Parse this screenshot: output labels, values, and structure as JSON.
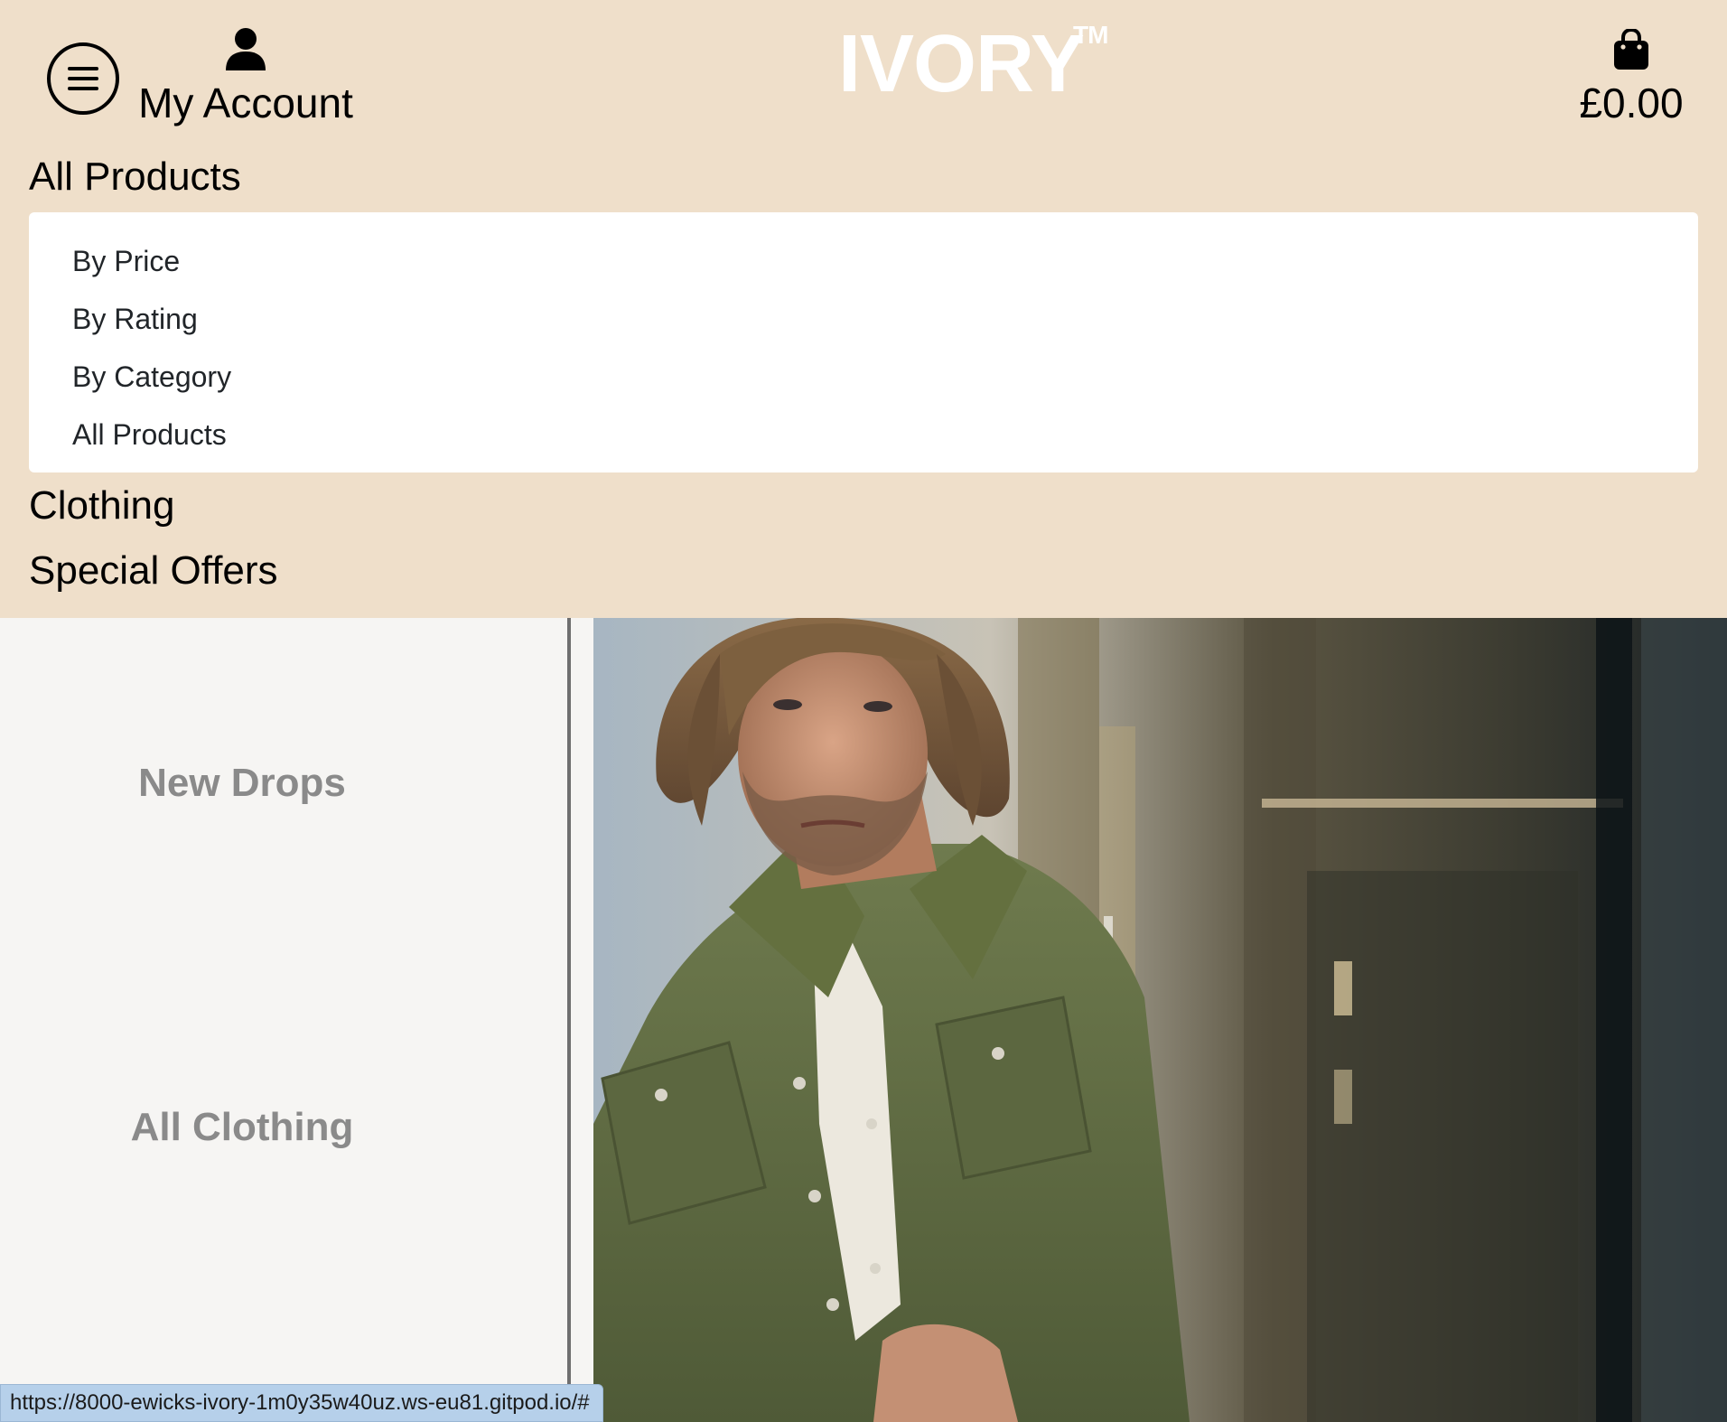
{
  "header": {
    "account_label": "My Account",
    "logo_text": "IVORY",
    "logo_tm": "TM",
    "bag_total": "£0.00",
    "background": "#efdfca"
  },
  "nav": {
    "all_products": "All Products",
    "dropdown": [
      "By Price",
      "By Rating",
      "By Category",
      "All Products"
    ],
    "clothing": "Clothing",
    "special_offers": "Special Offers"
  },
  "side_panel": {
    "new_drops": "New Drops",
    "all_clothing": "All Clothing"
  },
  "hero": {
    "image_alt": "man-in-olive-shirt-photo"
  },
  "status_bar": {
    "url": "https://8000-ewicks-ivory-1m0y35w40uz.ws-eu81.gitpod.io/#"
  }
}
